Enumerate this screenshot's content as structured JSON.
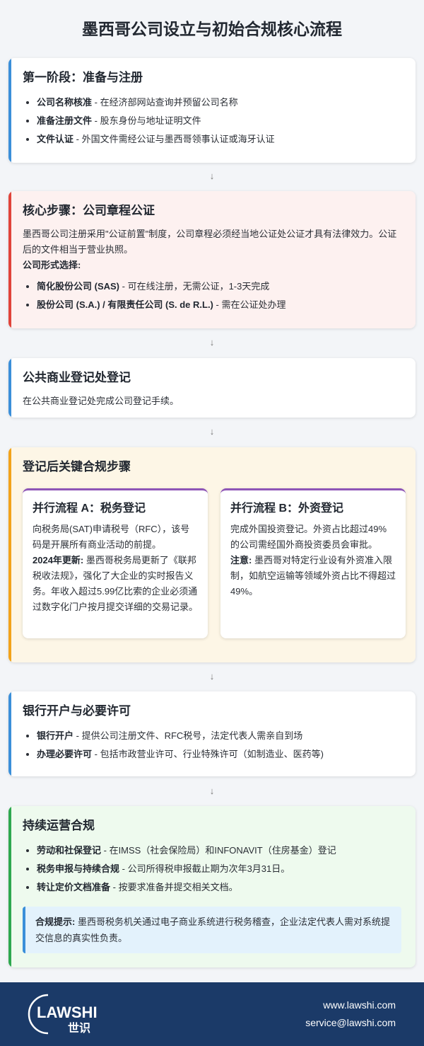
{
  "title": "墨西哥公司设立与初始合规核心流程",
  "arrow": "↓",
  "stage1": {
    "title": "第一阶段：准备与注册",
    "items": [
      {
        "label": "公司名称核准",
        "text": " - 在经济部网站查询并预留公司名称"
      },
      {
        "label": "准备注册文件",
        "text": " - 股东身份与地址证明文件"
      },
      {
        "label": "文件认证",
        "text": " - 外国文件需经公证与墨西哥领事认证或海牙认证"
      }
    ]
  },
  "core": {
    "title": "核心步骤：公司章程公证",
    "desc": "墨西哥公司注册采用\"公证前置\"制度，公司章程必须经当地公证处公证才具有法律效力。公证后的文件相当于营业执照。",
    "form_label": "公司形式选择:",
    "items": [
      {
        "label": "简化股份公司 (SAS)",
        "text": " - 可在线注册，无需公证，1-3天完成"
      },
      {
        "label": "股份公司 (S.A.) / 有限责任公司 (S. de R.L.)",
        "text": " - 需在公证处办理"
      }
    ]
  },
  "registry": {
    "title": "公共商业登记处登记",
    "desc": "在公共商业登记处完成公司登记手续。"
  },
  "post": {
    "title": "登记后关键合规步骤",
    "a": {
      "title": "并行流程 A：税务登记",
      "desc": "向税务局(SAT)申请税号（RFC），该号码是开展所有商业活动的前提。",
      "update_label": "2024年更新:",
      "update_text": " 墨西哥税务局更新了《联邦税收法规》，强化了大企业的实时报告义务。年收入超过5.99亿比索的企业必须通过数字化门户按月提交详细的交易记录。"
    },
    "b": {
      "title": "并行流程 B：外资登记",
      "desc": "完成外国投资登记。外资占比超过49%的公司需经国外商投资委员会审批。",
      "note_label": "注意:",
      "note_text": " 墨西哥对特定行业设有外资准入限制，如航空运输等领域外资占比不得超过49%。"
    }
  },
  "bank": {
    "title": "银行开户与必要许可",
    "items": [
      {
        "label": "银行开户",
        "text": " - 提供公司注册文件、RFC税号，法定代表人需亲自到场"
      },
      {
        "label": "办理必要许可",
        "text": " - 包括市政营业许可、行业特殊许可（如制造业、医药等)"
      }
    ]
  },
  "ongoing": {
    "title": "持续运营合规",
    "items": [
      {
        "label": "劳动和社保登记",
        "text": " - 在IMSS（社会保险局）和INFONAVIT（住房基金）登记"
      },
      {
        "label": "税务申报与持续合规",
        "text": " - 公司所得税申报截止期为次年3月31日。"
      },
      {
        "label": "转让定价文档准备",
        "text": " - 按要求准备并提交相关文档。"
      }
    ],
    "tip_label": "合规提示:",
    "tip_text": " 墨西哥税务机关通过电子商业系统进行税务稽查，企业法定代表人需对系统提交信息的真实性负责。"
  },
  "footer": {
    "logo_text": "LAWSHI",
    "logo_cn": "世识",
    "website": "www.lawshi.com",
    "email": "service@lawshi.com"
  },
  "colors": {
    "blue": "#3b8fd9",
    "red": "#e0443a",
    "orange": "#f2a31b",
    "green": "#2ea84f",
    "purple": "#8e55b7",
    "footer": "#1b3a68"
  }
}
